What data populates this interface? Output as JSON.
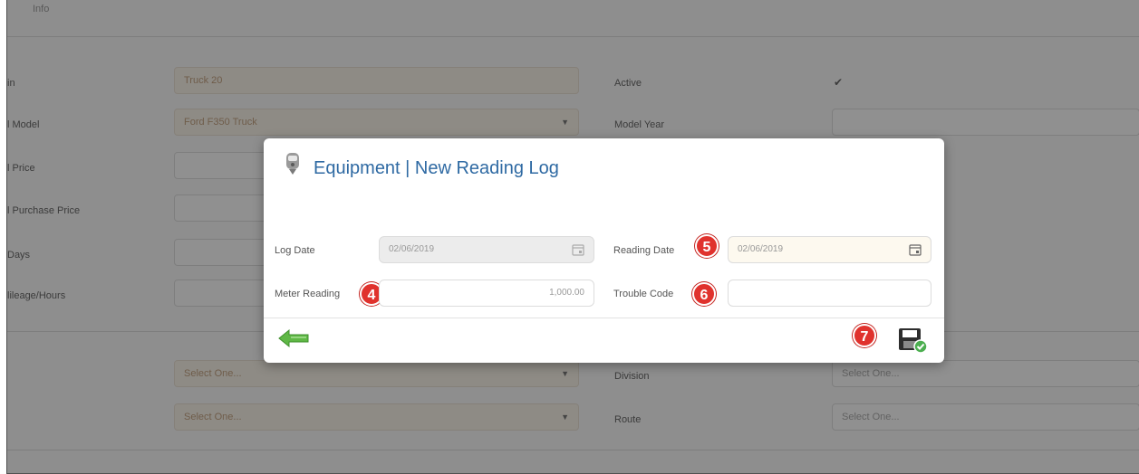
{
  "background": {
    "top_text": "Info",
    "rows": [
      {
        "left_label": "in",
        "left_value": "Truck 20",
        "right_label": "Active",
        "right_check": "✔"
      },
      {
        "left_label": "l Model",
        "left_value": "Ford F350 Truck",
        "right_label": "Model Year",
        "right_value": ""
      },
      {
        "left_label": "l Price",
        "left_value": ""
      },
      {
        "left_label": "l Purchase Price",
        "left_value": ""
      },
      {
        "left_label": "Days",
        "left_value": ""
      },
      {
        "left_label": "lileage/Hours",
        "left_value": ""
      }
    ],
    "lower_rows": [
      {
        "left_value": "Select One...",
        "right_label": "Division",
        "right_value": "Select One..."
      },
      {
        "left_value": "Select One...",
        "right_label": "Route",
        "right_value": "Select One..."
      }
    ]
  },
  "modal": {
    "title": "Equipment | New Reading Log",
    "log_date_label": "Log Date",
    "log_date_value": "02/06/2019",
    "reading_date_label": "Reading Date",
    "reading_date_value": "02/06/2019",
    "meter_reading_label": "Meter Reading",
    "meter_reading_value": "1,000.00",
    "trouble_code_label": "Trouble Code",
    "trouble_code_value": "",
    "badges": {
      "meter": "4",
      "reading_date": "5",
      "trouble": "6",
      "save": "7"
    }
  },
  "colors": {
    "title": "#2f6aa3",
    "badge": "#e0322d",
    "back_arrow": "#5fb846",
    "save_check": "#4caf50"
  }
}
